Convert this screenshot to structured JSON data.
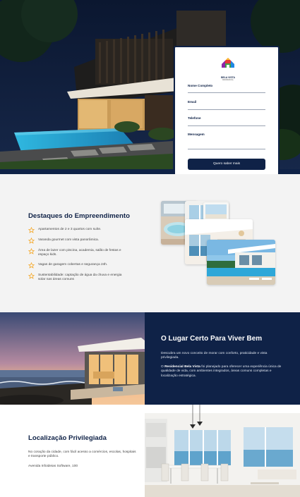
{
  "brand": {
    "name": "BELA VISTA",
    "tagline": "RESIDENCIAL"
  },
  "form": {
    "fields": [
      {
        "label": "Nome Completo"
      },
      {
        "label": "Email"
      },
      {
        "label": "Telefone"
      },
      {
        "label": "Mensagem"
      }
    ],
    "submit_label": "Quero saber mais"
  },
  "highlights": {
    "title": "Destaques do Empreendimento",
    "items": [
      "Apartamentos de 2 e 3 quartos com suíte.",
      "Varanda gourmet com vista panorâmica.",
      "Área de lazer com piscina, academia, salão de festas e espaço kids.",
      "Vagas de garagem cobertas e segurança 24h.",
      "Sustentabilidade: captação de água da chuva e energia solar nas áreas comuns"
    ]
  },
  "lugar": {
    "title": "O Lugar Certo Para Viver Bem",
    "p1": "Descubra um novo conceito de morar com conforto, praticidade e vista privilegiada.",
    "p2_prefix": "O ",
    "p2_strong": "Residencial Bela Vista",
    "p2_suffix": " foi planejado para oferecer uma experiência única de qualidade de vida, com ambientes integrados, áreas comuns completas e localização estratégica."
  },
  "localizacao": {
    "title": "Localização Privilegiada",
    "text": "No coração da cidade, com fácil acesso a comércios, escolas, hospitais e transporte público.",
    "address": "Avenida Infoideias Software, 100"
  },
  "colors": {
    "navy": "#0f2247",
    "accent": "#f5a623",
    "light_bg": "#f3f3f3"
  }
}
